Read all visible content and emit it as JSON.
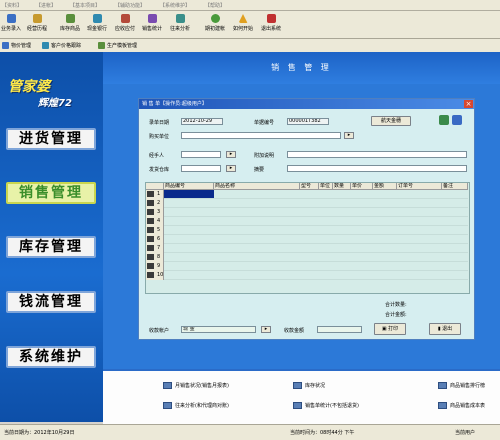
{
  "menu": [
    "【资料】",
    "【进帐】",
    "【基本项目】",
    "【辅助功能】",
    "【系统维护】",
    "【帮助】"
  ],
  "toolbar": [
    {
      "label": "业务录入",
      "icon": "data-entry-icon",
      "color": "#3b6fc4"
    },
    {
      "label": "经营历程",
      "icon": "history-icon",
      "color": "#c79a2e"
    },
    {
      "label": "库存商品",
      "icon": "inventory-icon",
      "color": "#5a8f3c"
    },
    {
      "label": "现金银行",
      "icon": "bank-icon",
      "color": "#2f8ab0"
    },
    {
      "label": "应收应付",
      "icon": "receivable-icon",
      "color": "#b44a3a"
    },
    {
      "label": "销售统计",
      "icon": "sales-stat-icon",
      "color": "#7a4bb0"
    },
    {
      "label": "往来分析",
      "icon": "analysis-icon",
      "color": "#3a8f8a"
    },
    {
      "label": "期初建帐",
      "icon": "opening-icon",
      "color": "#4a9a3a"
    },
    {
      "label": "如何开始",
      "icon": "help-warning-icon",
      "color": "#e0a020"
    },
    {
      "label": "退出系统",
      "icon": "exit-icon",
      "color": "#c03030"
    }
  ],
  "quickbar": [
    {
      "label": "物价管理",
      "icon": "price-icon"
    },
    {
      "label": "客户价格跟踪",
      "icon": "customer-price-icon"
    },
    {
      "label": "生产模板管理",
      "icon": "production-template-icon"
    }
  ],
  "logo": {
    "line1": "管家婆",
    "line2": "辉煌72"
  },
  "nav": [
    {
      "label": "进货管理",
      "active": false
    },
    {
      "label": "销售管理",
      "active": true
    },
    {
      "label": "库存管理",
      "active": false
    },
    {
      "label": "钱流管理",
      "active": false
    },
    {
      "label": "系统维护",
      "active": false
    }
  ],
  "main": {
    "title": "销 售 管 理"
  },
  "dialog": {
    "title": "销 售 单【操作员:超级用户】",
    "entry_date_label": "录单日期",
    "entry_date_value": "2012-10-29",
    "doc_no_label": "单据编号",
    "doc_no_value": "000001T382",
    "pick_up_button": "航天金穗",
    "buyer_label": "购买单位",
    "handler_label": "经手人",
    "remark_label": "附加说明",
    "warehouse_label": "发货仓库",
    "summary_label": "摘要",
    "columns": [
      "商品编号",
      "商品名称",
      "型号",
      "单位",
      "数量",
      "单价",
      "金额",
      "订单号",
      "备注"
    ],
    "rows": [
      "1",
      "2",
      "3",
      "4",
      "5",
      "6",
      "7",
      "8",
      "9",
      "10"
    ],
    "total_qty_label": "合计数量:",
    "total_amount_label": "合计金额:",
    "account_label": "收款帐户",
    "account_value": "现  金",
    "received_label": "收款金额",
    "print_button": "打印",
    "exit_button": "退出"
  },
  "links": [
    {
      "label": "月销售状况(销售月报表)"
    },
    {
      "label": "库存状况"
    },
    {
      "label": "商品销售排行榜"
    },
    {
      "label": "往来分析(和代理商对账)"
    },
    {
      "label": "销售单统计(不包括退货)"
    },
    {
      "label": "商品销售成本表"
    }
  ],
  "status": {
    "date": "当前日期为：2012年10月29日",
    "time": "当前时间为：08时44分  下午",
    "user": "当前用户"
  }
}
